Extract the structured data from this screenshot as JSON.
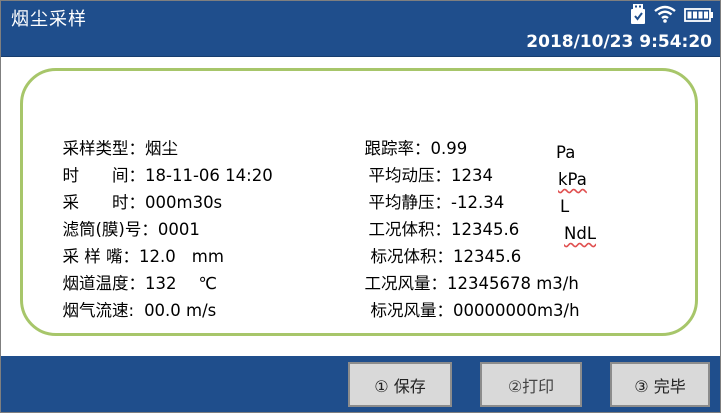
{
  "header": {
    "title": "烟尘采样",
    "datetime": "2018/10/23 9:54:20",
    "icons": [
      "usb-icon",
      "wifi-icon",
      "battery-icon"
    ]
  },
  "left": [
    {
      "label": "采样类型：",
      "value": "烟尘",
      "unit": ""
    },
    {
      "label": "时　　间：",
      "value": "18-11-06 14:20",
      "unit": ""
    },
    {
      "label": "采　　时：",
      "value": "000m30s",
      "unit": ""
    },
    {
      "label": "滤筒(膜)号：",
      "value": "0001",
      "unit": ""
    },
    {
      "label": "采 样 嘴：",
      "value": "12.0",
      "unit": "mm"
    },
    {
      "label": "烟道温度：",
      "value": "132",
      "unit": "℃"
    },
    {
      "label": "烟气流速:",
      "value": "00.0 m/s",
      "unit": ""
    }
  ],
  "right": [
    {
      "label": "跟踪率：",
      "value": "0.99",
      "unit": ""
    },
    {
      "label": "平均动压：",
      "value": "1234",
      "unit": "Pa"
    },
    {
      "label": "平均静压：",
      "value": "-12.34",
      "unit": "kPa"
    },
    {
      "label": "工况体积：",
      "value": "12345.6",
      "unit": "L"
    },
    {
      "label": "标况体积：",
      "value": "12345.6",
      "unit": "NdL"
    },
    {
      "label": "工况风量：",
      "value": "12345678 m3/h",
      "unit": ""
    },
    {
      "label": "标况风量：",
      "value": "00000000m3/h",
      "unit": ""
    }
  ],
  "buttons": {
    "save": "① 保存",
    "print": "②打印",
    "finish": "③ 完毕"
  },
  "colors": {
    "header_bg": "#1f4e8c",
    "card_border": "#a7c66a",
    "button_bg": "#d9d9d9"
  }
}
